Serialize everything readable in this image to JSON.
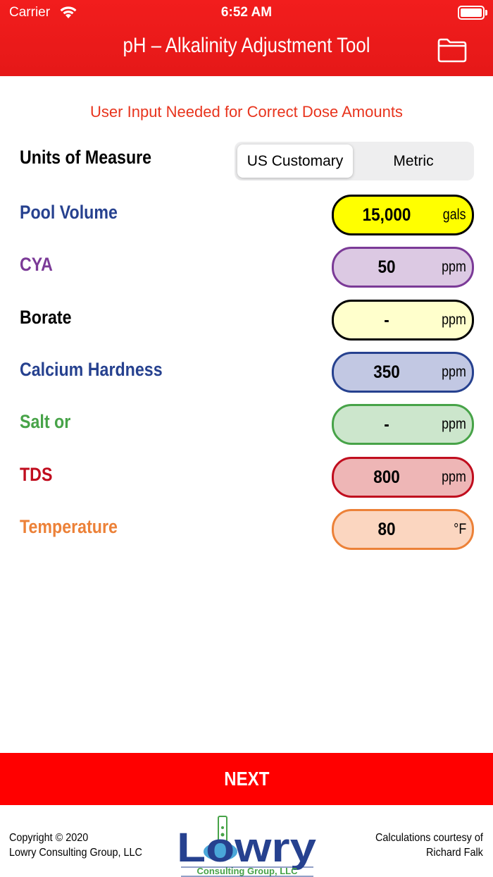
{
  "status": {
    "carrier": "Carrier",
    "time": "6:52 AM"
  },
  "header": {
    "title": "pH – Alkalinity Adjustment Tool"
  },
  "hint": "User Input Needed for Correct Dose Amounts",
  "units": {
    "label": "Units of Measure",
    "options": [
      "US Customary",
      "Metric"
    ],
    "selected": "US Customary"
  },
  "fields": [
    {
      "label": "Pool Volume",
      "value": "15,000",
      "unit": "gals",
      "label_color": "#26418f",
      "bg": "#ffff00",
      "border": "#000000"
    },
    {
      "label": "CYA",
      "value": "50",
      "unit": "ppm",
      "label_color": "#7b3a97",
      "bg": "#dcc9e3",
      "border": "#7b3a97"
    },
    {
      "label": "Borate",
      "value": "-",
      "unit": "ppm",
      "label_color": "#000000",
      "bg": "#ffffcc",
      "border": "#000000"
    },
    {
      "label": "Calcium Hardness",
      "value": "350",
      "unit": "ppm",
      "label_color": "#26418f",
      "bg": "#c2c8e3",
      "border": "#26418f"
    },
    {
      "label": "Salt or",
      "value": "-",
      "unit": "ppm",
      "label_color": "#47a348",
      "bg": "#cce6cc",
      "border": "#47a348"
    },
    {
      "label": "TDS",
      "value": "800",
      "unit": "ppm",
      "label_color": "#c00d1e",
      "bg": "#eeb6b6",
      "border": "#c00d1e"
    },
    {
      "label": "Temperature",
      "value": "80",
      "unit": "°F",
      "label_color": "#ec8138",
      "bg": "#fbd6c0",
      "border": "#ec8138"
    }
  ],
  "next_label": "NEXT",
  "footer": {
    "copyright_line1": "Copyright © 2020",
    "copyright_line2": "Lowry Consulting Group, LLC",
    "credits_line1": "Calculations courtesy of",
    "credits_line2": "Richard Falk",
    "logo_text": "Lowry",
    "logo_sub": "Consulting Group, LLC"
  },
  "colors": {
    "accent": "#ff0000",
    "header": "#f21d1d",
    "hint": "#e8341d",
    "logo_blue": "#26418f",
    "logo_green": "#47a348"
  }
}
